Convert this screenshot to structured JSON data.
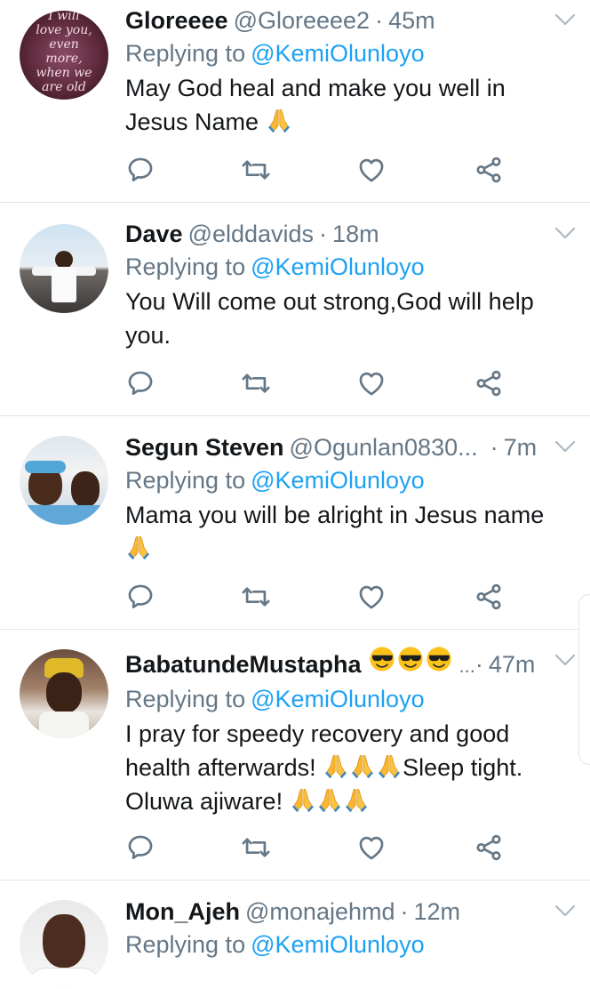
{
  "tweets": [
    {
      "name": "Gloreeee",
      "handle": "@Gloreeee2",
      "separator": "·",
      "time": "45m",
      "replying_label": "Replying to",
      "replying_to": "@KemiOlunloyo",
      "text_lines": [
        "May God heal and make you well in",
        "Jesus Name"
      ],
      "avatar_text": [
        "I will",
        "love you,",
        "even",
        "more,",
        "when we",
        "are old"
      ]
    },
    {
      "name": "Dave",
      "handle": "@elddavids",
      "separator": "·",
      "time": "18m",
      "replying_label": "Replying to",
      "replying_to": "@KemiOlunloyo",
      "text_lines": [
        "You Will come out strong,God will help",
        "you."
      ]
    },
    {
      "name": "Segun Steven",
      "handle": "@Ogunlan0830...",
      "separator": "·",
      "time": "7m",
      "replying_label": "Replying to",
      "replying_to": "@KemiOlunloyo",
      "text_lines": [
        "Mama you will be alright in Jesus name"
      ]
    },
    {
      "name": "BabatundeMustapha",
      "handle": "...",
      "separator": "·",
      "time": "47m",
      "replying_label": "Replying to",
      "replying_to": "@KemiOlunloyo",
      "text_lines": [
        "I pray for speedy recovery and good",
        "health afterwards!",
        "Sleep tight.",
        "Oluwa ajiware!"
      ]
    },
    {
      "name": "Mon_Ajeh",
      "handle": "@monajehmd",
      "separator": "·",
      "time": "12m",
      "replying_label": "Replying to",
      "replying_to": "@KemiOlunloyo"
    }
  ],
  "icons": {
    "reply": "reply-icon",
    "retweet": "retweet-icon",
    "like": "like-icon",
    "share": "share-icon",
    "menu": "chevron-down-icon",
    "pray": "folded-hands-emoji",
    "cool": "sunglasses-emoji"
  },
  "colors": {
    "accent": "#1da1f2",
    "secondary_text": "#657786",
    "divider": "#dfe5ea"
  }
}
